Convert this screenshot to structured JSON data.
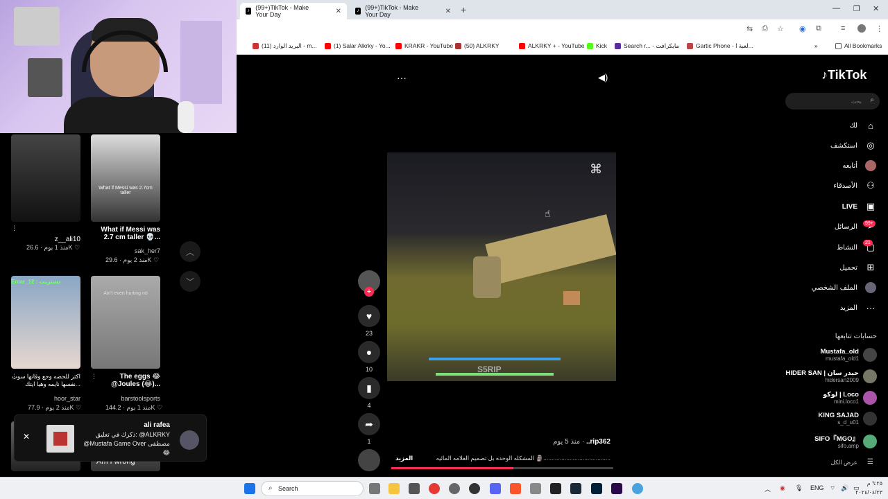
{
  "browser": {
    "tabs": [
      {
        "title": "(99+)TikTok - Make Your Day",
        "active": true
      },
      {
        "title": "(99+)TikTok - Make Your Day",
        "active": false
      }
    ],
    "bookmarks": [
      "البريد الوارد (11) - m...",
      "(1) Salar Alkrky - Yo...",
      "KRAKR - YouTube",
      "(50) ALKRKY",
      "ALKRKY + - YouTube",
      "Kick",
      "Search r... - مايكرافت",
      "Gartic Phone - لعبة ا..."
    ],
    "all_bookmarks": "All Bookmarks"
  },
  "tiktok": {
    "logo": "TikTok",
    "search_placeholder": "بحث",
    "nav": [
      {
        "label": "لك",
        "icon": "home-icon"
      },
      {
        "label": "استكشف",
        "icon": "compass-icon"
      },
      {
        "label": "أتابعه",
        "icon": "avatar-icon"
      },
      {
        "label": "الأصدقاء",
        "icon": "friends-icon"
      },
      {
        "label": "LIVE",
        "icon": "live-icon"
      },
      {
        "label": "الرسائل",
        "icon": "messages-icon",
        "badge": "99+"
      },
      {
        "label": "النشاط",
        "icon": "activity-icon",
        "badge": "21"
      },
      {
        "label": "تحميل",
        "icon": "upload-icon"
      },
      {
        "label": "الملف الشخصي",
        "icon": "profile-icon"
      },
      {
        "label": "المزيد",
        "icon": "more-icon"
      }
    ],
    "following_title": "حسابات تتابعها",
    "following": [
      {
        "name": "Mustafa_old",
        "handle": "mustafa_old1"
      },
      {
        "name": "HIDER SAN | حيدر سان",
        "handle": "hidersan2009"
      },
      {
        "name": "لوكو | Loco",
        "handle": "mini.loco1"
      },
      {
        "name": "KING SAJAD",
        "handle": "s_d_u01"
      },
      {
        "name": "SIFO『MGO』",
        "handle": "sifo.amp"
      }
    ],
    "see_all": "عرض الكل",
    "video": {
      "likes": "23",
      "comments": "10",
      "saves": "4",
      "shares": "1",
      "author": "..rip362",
      "time": "منذ 5 يوم",
      "caption": "المشكله الوحده بل تصميم العلامه المائيه 🗿.........................................",
      "more": "المزيد",
      "hud_text": "S5RIP",
      "progress": 0.55
    },
    "grid": [
      {
        "handle": "z__ali10",
        "likes": "26.6K",
        "time": "منذ 1 يوم",
        "title": ""
      },
      {
        "handle": "sak_her7",
        "likes": "29.6K",
        "time": "منذ 2 يوم",
        "title": "What if Messi was 2.7 cm taller 💀...",
        "overlay": "What if Messi was 2.7cm taller"
      },
      {
        "handle": "hoor_star",
        "likes": "77.9K",
        "time": "منذ 2 يوم",
        "title": "اكثر للحضه وجع وقاتها سوت نفسها نايمه وهيا ايتك...",
        "overlay": "Emar_12 : تشتريت"
      },
      {
        "handle": "barstoolsports",
        "likes": "144.2K",
        "time": "منذ 1 يوم",
        "title": "The eggs 😂 @Joules (😂)...",
        "overlay": "Ain't even hurting no"
      }
    ],
    "notification": {
      "name": "ali rafea",
      "text": "ذكرك في تعليق: @ALKRKY @Mustafa Game Over مصطفى 😂",
      "thumb_caption": "Am I wrong"
    }
  },
  "taskbar": {
    "search": "Search",
    "lang": "ENG",
    "time": "٦:٢٥ م",
    "date": "٢٠٢٤/٠٤/٢٣"
  },
  "colors": {
    "accent": "#fe2c55",
    "chrome_bg": "#dfe3ea"
  }
}
